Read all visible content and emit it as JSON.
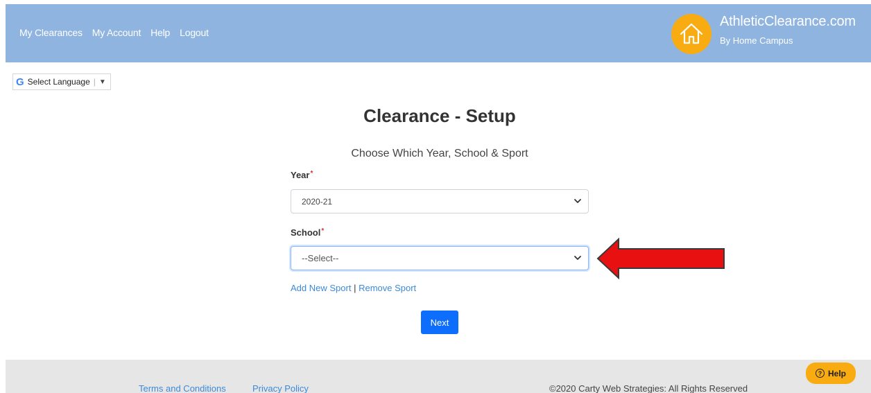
{
  "nav": {
    "items": [
      {
        "label": "My Clearances"
      },
      {
        "label": "My Account"
      },
      {
        "label": "Help"
      },
      {
        "label": "Logout"
      }
    ]
  },
  "brand": {
    "title": "AthleticClearance.com",
    "subtitle": "By Home Campus",
    "icon": "house-icon",
    "color": "#f9ac12"
  },
  "translate": {
    "label": "Select Language",
    "icon": "google-g-icon"
  },
  "main": {
    "title": "Clearance - Setup",
    "subtitle": "Choose Which Year, School & Sport",
    "year": {
      "label": "Year",
      "required_mark": "*",
      "value": "2020-21"
    },
    "school": {
      "label": "School",
      "required_mark": "*",
      "value": "--Select--"
    },
    "add_sport": "Add New Sport",
    "separator": "|",
    "remove_sport": "Remove Sport",
    "next_label": "Next"
  },
  "footer": {
    "terms": "Terms and Conditions",
    "privacy": "Privacy Policy",
    "copyright": "©2020 Carty Web Strategies: All Rights Reserved"
  },
  "help_button": {
    "label": "Help",
    "icon": "question-circle-icon"
  },
  "colors": {
    "header_bg": "#8fb4e0",
    "accent": "#0d6efd",
    "link": "#3b8ad8",
    "arrow": "#e81010"
  }
}
